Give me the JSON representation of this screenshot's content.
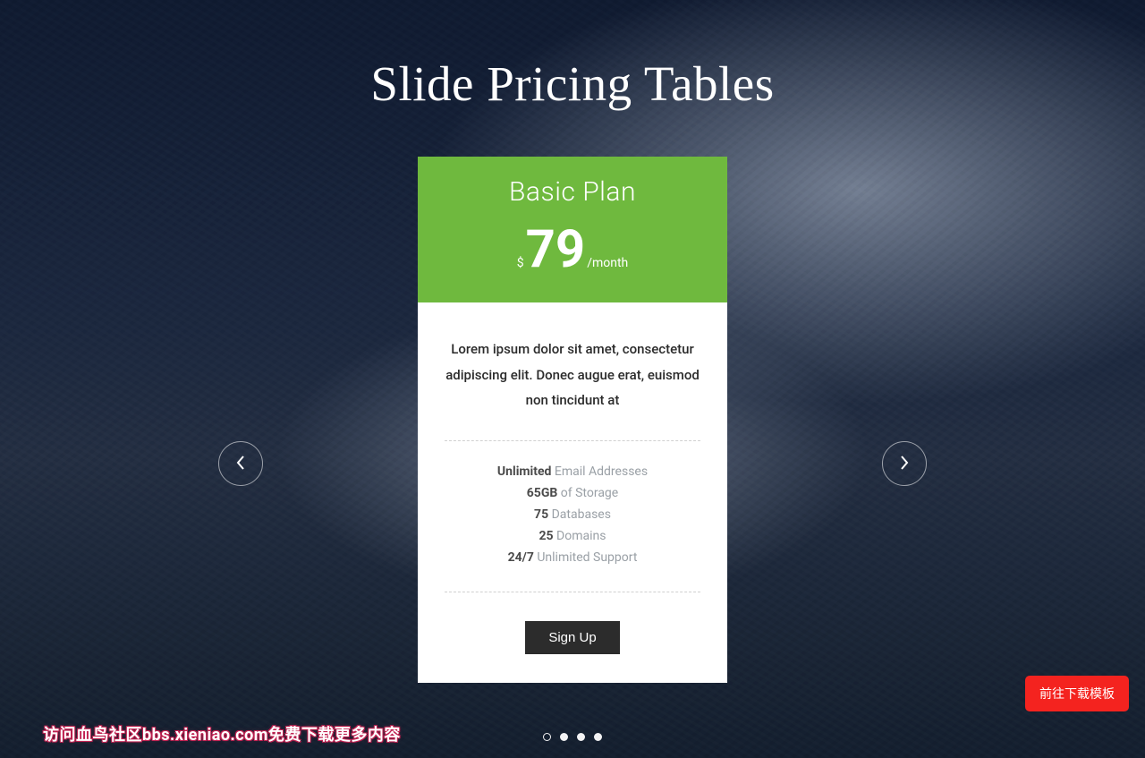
{
  "title": "Slide Pricing Tables",
  "card": {
    "name": "Basic Plan",
    "currency": "$",
    "amount": "79",
    "period": "/month",
    "description": "Lorem ipsum dolor sit amet, consectetur adipiscing elit. Donec augue erat, euismod non tincidunt at",
    "features": [
      {
        "bold": "Unlimited",
        "text": " Email Addresses"
      },
      {
        "bold": "65GB",
        "text": " of Storage"
      },
      {
        "bold": "75",
        "text": " Databases"
      },
      {
        "bold": "25",
        "text": " Domains"
      },
      {
        "bold": "24/7",
        "text": " Unlimited Support"
      }
    ],
    "cta": "Sign Up"
  },
  "dots": {
    "count": 4,
    "active": 0
  },
  "download_label": "前往下载模板",
  "watermark": "访问血鸟社区bbs.xieniao.com免费下载更多内容"
}
